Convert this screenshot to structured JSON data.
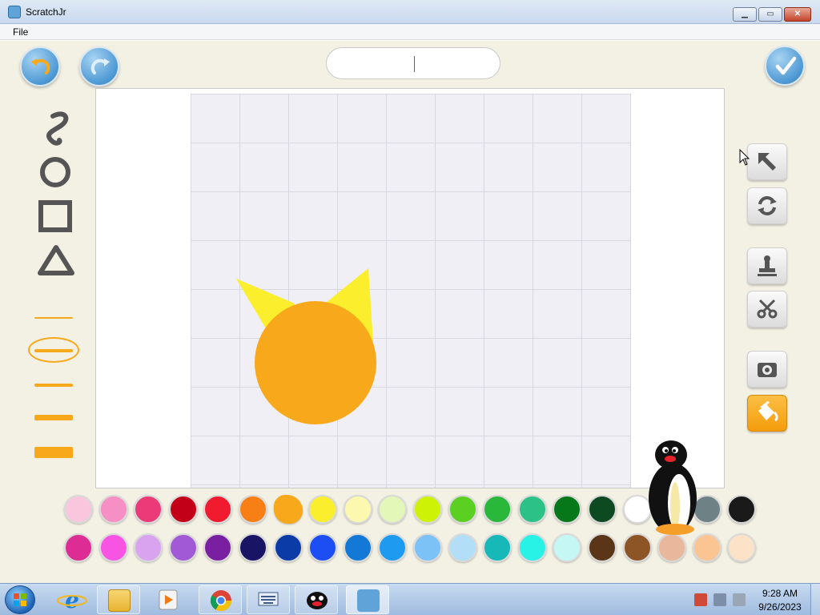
{
  "window": {
    "title": "ScratchJr",
    "minimize_label": "▁",
    "maximize_label": "▭",
    "close_label": "✕"
  },
  "menu": {
    "file_label": "File"
  },
  "editor": {
    "name_field_value": "",
    "drawing_tools": [
      "curve-tool",
      "circle-tool",
      "rectangle-tool",
      "triangle-tool"
    ],
    "line_widths": [
      "thin",
      "medium",
      "thick",
      "thicker",
      "thickest"
    ],
    "selected_line_width": "medium",
    "right_tools": [
      "select",
      "rotate",
      "stamp",
      "cut",
      "camera",
      "fill"
    ],
    "active_tool": "fill",
    "palette_row1": [
      "#f9c6dd",
      "#f58fc4",
      "#ec3a78",
      "#c20017",
      "#f01b2e",
      "#f77f15",
      "#f7a81b",
      "#fbee2c",
      "#fcf8b0",
      "#e2f7b8",
      "#cef205",
      "#5bd022",
      "#29b83a",
      "#2cc186",
      "#07781a",
      "#0d4a22",
      "#ffffff",
      "#c9c9c9",
      "#6e8286",
      "#1a1a1a"
    ],
    "palette_row2": [
      "#dd2c93",
      "#f754e3",
      "#d9a3f0",
      "#a159d6",
      "#7b1fa2",
      "#1a1464",
      "#0a3ba7",
      "#1c4ef3",
      "#1479d6",
      "#1e9bf0",
      "#7cc2f6",
      "#b2def7",
      "#16b9b7",
      "#27f2e5",
      "#c5f8f4",
      "#5b3517",
      "#8d5526",
      "#e8b79c",
      "#fbc493",
      "#fce2c7"
    ],
    "selected_color": "#f7a81b"
  },
  "taskbar": {
    "apps": [
      "explorer-folder",
      "media-player",
      "chrome",
      "keyboard-app",
      "pingu-app",
      "scratchjr"
    ],
    "clock_time": "9:28 AM",
    "clock_date": "9/26/2023"
  }
}
